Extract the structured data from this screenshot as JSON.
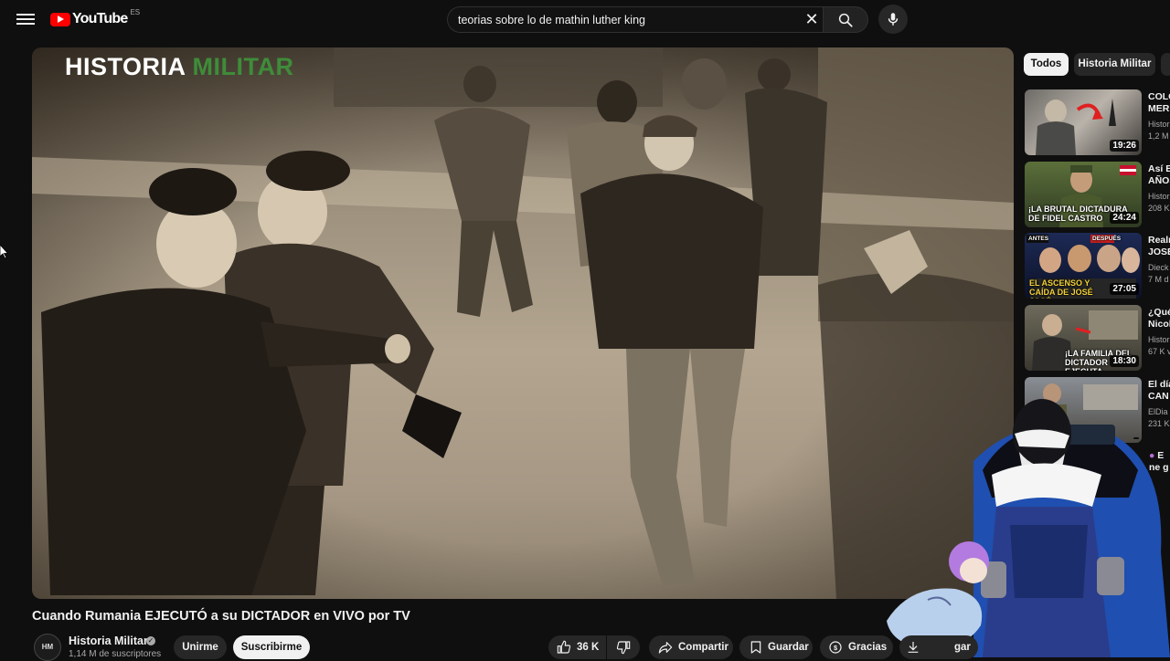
{
  "header": {
    "logo_text": "YouTube",
    "country_code": "ES",
    "search_query": "teorias sobre lo de mathin luther king"
  },
  "player": {
    "watermark_part1": "HISTORIA",
    "watermark_part2": "MILITAR"
  },
  "video": {
    "title": "Cuando Rumania EJECUTÓ a su DICTADOR en VIVO por TV",
    "channel_name": "Historia Militar",
    "channel_avatar_text": "HM",
    "subscribers": "1,14 M de suscriptores",
    "join_label": "Unirme",
    "subscribe_label": "Suscribirme",
    "likes": "36 K",
    "share_label": "Compartir",
    "save_label": "Guardar",
    "thanks_label": "Gracias",
    "download_label_partial": "gar"
  },
  "chips": [
    "Todos",
    "Historia Militar"
  ],
  "recommendations": [
    {
      "title1": "COLG",
      "title2": "MER",
      "channel": "Histor",
      "views": "1,2 M",
      "duration": "19:26",
      "thumb_text": ""
    },
    {
      "title1": "Así E",
      "title2": "AÑOS",
      "channel": "Histor",
      "views": "208 K",
      "duration": "24:24",
      "thumb_text": "¡LA BRUTAL DICTADURA DE FIDEL CASTRO"
    },
    {
      "title1": "Realm",
      "title2": "JOSÉ",
      "channel": "Dieck",
      "views": "7 M d",
      "duration": "27:05",
      "thumb_text": "EL ASCENSO Y CAÍDA DE JOSÉ JOSÉ"
    },
    {
      "title1": "¿Qué",
      "title2": "Nicol",
      "channel": "Histor",
      "views": "67 K v",
      "duration": "18:30",
      "thumb_text": "¡LA FAMILIA DEL DICTADOR EJECUTA"
    },
    {
      "title1": "El día",
      "title2": "CAN",
      "channel": "ElDia",
      "views": "231 K",
      "duration": "",
      "thumb_text": ""
    },
    {
      "title1": "E",
      "title2": "ne g",
      "channel": "",
      "views": "",
      "duration": "",
      "thumb_text": ""
    }
  ],
  "thumb_badges": {
    "before": "ANTES",
    "after": "DESPUÉS"
  },
  "colors": {
    "background": "#0f0f0f",
    "brand_red": "#ff0000",
    "watermark_green": "#3e8c3a",
    "chip_active": "#f1f1f1"
  }
}
